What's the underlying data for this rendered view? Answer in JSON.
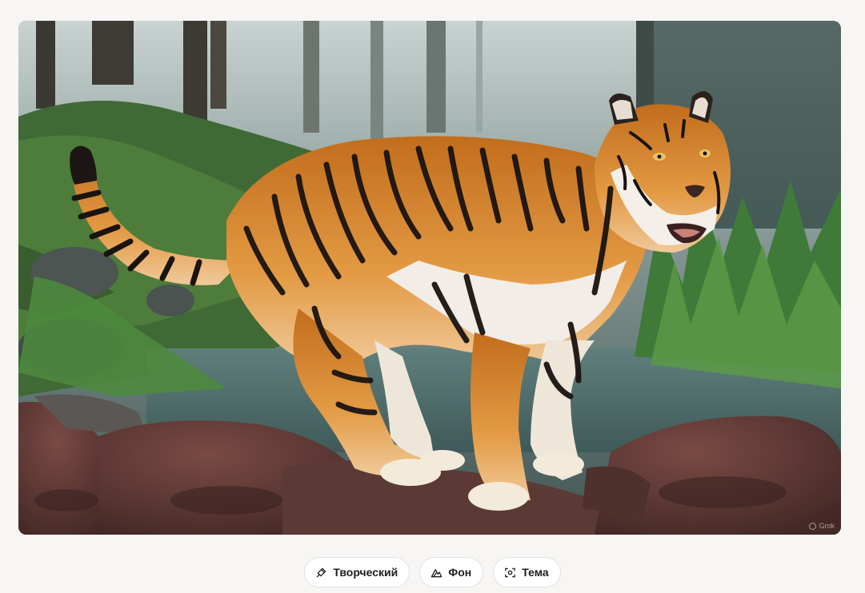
{
  "image": {
    "alt": "",
    "watermark": "Grok"
  },
  "actions": [
    {
      "label": "Творческий",
      "icon": "brush-icon"
    },
    {
      "label": "Фон",
      "icon": "mountain-icon"
    },
    {
      "label": "Тема",
      "icon": "focus-icon"
    }
  ],
  "colors": {
    "page_bg": "#f7f6f4",
    "chip_bg": "#ffffff",
    "chip_border": "#e4e2de",
    "text": "#1e1e1e",
    "tiger_orange": "#d9892f"
  }
}
